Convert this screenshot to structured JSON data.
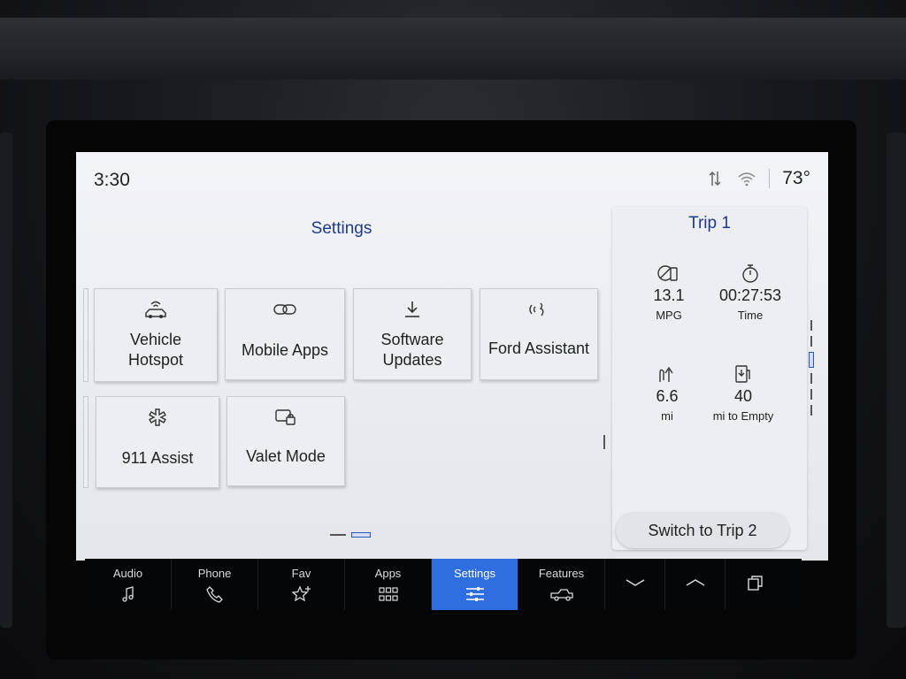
{
  "status_bar": {
    "time": "3:30",
    "temperature": "73°"
  },
  "settings": {
    "title": "Settings",
    "tiles": [
      {
        "label": "Vehicle\nHotspot",
        "icon": "car-wifi-icon"
      },
      {
        "label": "Mobile Apps",
        "icon": "link-icon"
      },
      {
        "label": "Software\nUpdates",
        "icon": "download-icon"
      },
      {
        "label": "Ford Assistant",
        "icon": "assistant-voice-icon"
      },
      {
        "label": "911 Assist",
        "icon": "medical-star-icon"
      },
      {
        "label": "Valet Mode",
        "icon": "valet-lock-icon"
      }
    ]
  },
  "trip": {
    "title": "Trip 1",
    "stats": [
      {
        "value": "13.1",
        "unit": "MPG",
        "icon": "fuel-economy-icon"
      },
      {
        "value": "00:27:53",
        "unit": "Time",
        "icon": "stopwatch-icon"
      },
      {
        "value": "6.6",
        "unit": "mi",
        "icon": "distance-icon"
      },
      {
        "value": "40",
        "unit": "mi to Empty",
        "icon": "fuel-range-icon"
      }
    ],
    "switch_label": "Switch to Trip 2"
  },
  "nav": {
    "items": [
      {
        "label": "Audio",
        "icon": "music-note-icon",
        "active": false
      },
      {
        "label": "Phone",
        "icon": "phone-icon",
        "active": false
      },
      {
        "label": "Fav",
        "icon": "star-plus-icon",
        "active": false
      },
      {
        "label": "Apps",
        "icon": "grid-icon",
        "active": false
      },
      {
        "label": "Settings",
        "icon": "sliders-icon",
        "active": true
      },
      {
        "label": "Features",
        "icon": "truck-icon",
        "active": false
      }
    ]
  },
  "colors": {
    "accent": "#2f6ee0",
    "title_blue": "#1e3a8a",
    "screen_bg": "#eceef1",
    "nav_bg": "#050608"
  }
}
